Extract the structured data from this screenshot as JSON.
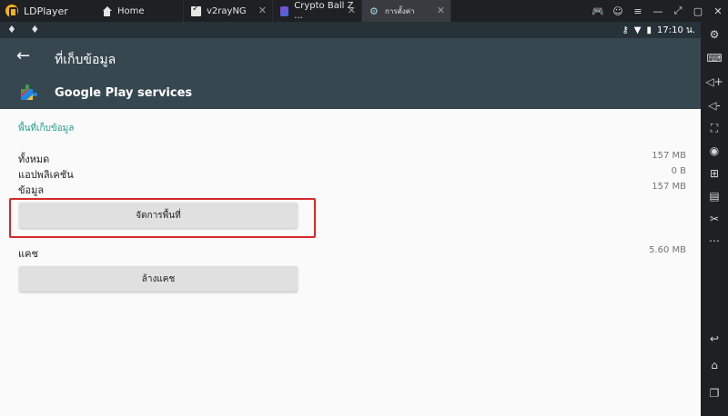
{
  "titlebar": {
    "app_name": "LDPlayer",
    "tabs": [
      {
        "label": "Home",
        "icon": "home-icon",
        "closable": false
      },
      {
        "label": "v2rayNG",
        "icon": "v2rayng-icon",
        "closable": true
      },
      {
        "label": "Crypto Ball Z ...",
        "icon": "game-icon",
        "closable": true
      },
      {
        "label": "การตั้งค่า",
        "icon": "settings-icon",
        "closable": true,
        "active": true
      }
    ],
    "close_glyph": "✕"
  },
  "statusbar": {
    "left_icons": "♦ ♦",
    "time": "17:10 น."
  },
  "appbar": {
    "back_glyph": "←",
    "title": "ที่เก็บข้อมูล"
  },
  "app_header": {
    "app_name": "Google Play services"
  },
  "storage": {
    "section_title": "พื้นที่เก็บข้อมูล",
    "rows": [
      {
        "label": "ทั้งหมด",
        "value": "157 MB"
      },
      {
        "label": "แอปพลิเคชัน",
        "value": "0 B"
      },
      {
        "label": "ข้อมูล",
        "value": "157 MB"
      }
    ],
    "manage_button": "จัดการพื้นที่"
  },
  "cache": {
    "label": "แคช",
    "value": "5.60 MB",
    "clear_button": "ล้างแคช"
  },
  "colors": {
    "appbar": "#37474f",
    "statusbar": "#263238",
    "accent": "#1e9e91",
    "highlight": "#d42a2a"
  }
}
